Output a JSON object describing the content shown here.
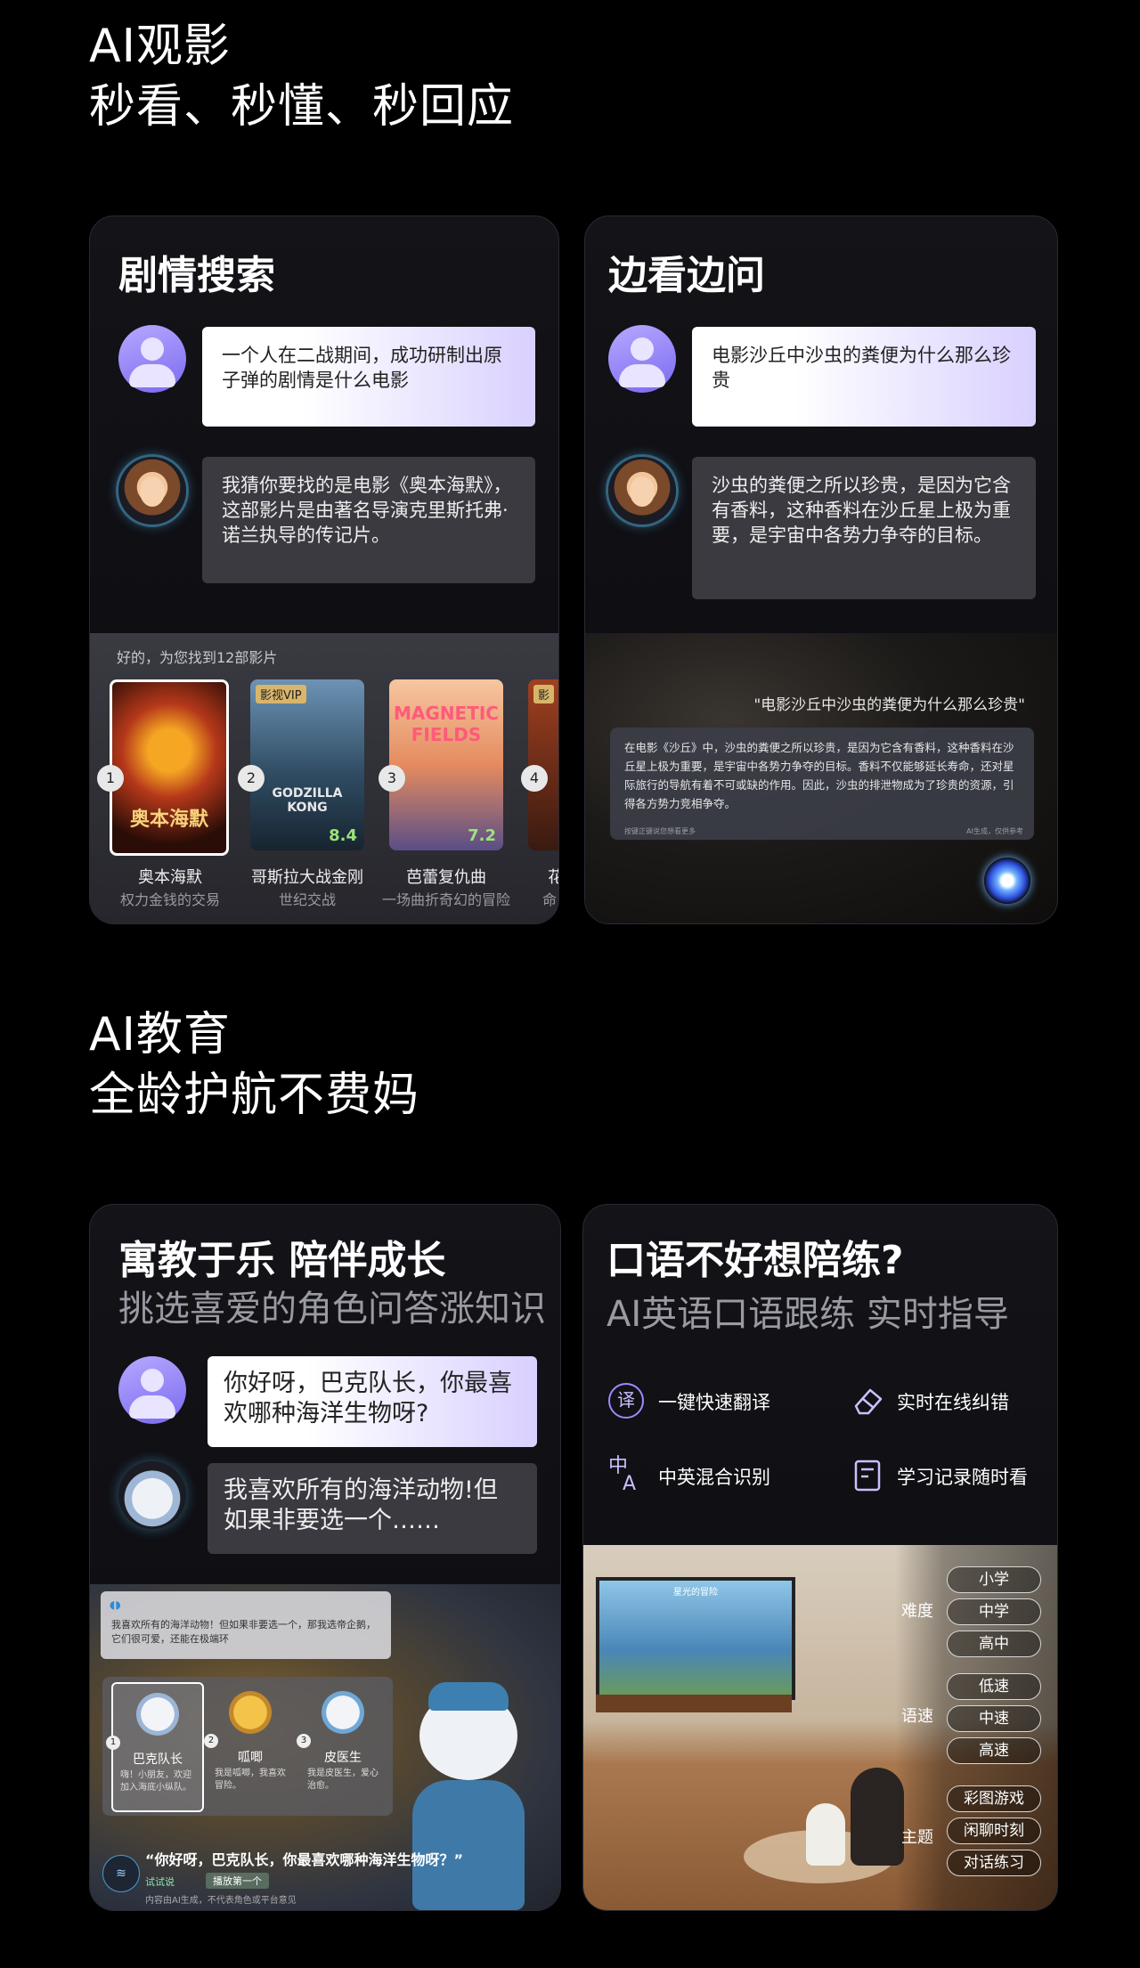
{
  "section1": {
    "title_line1": "AI观影",
    "title_line2": "秒看、秒懂、秒回应"
  },
  "card_search": {
    "title": "剧情搜索",
    "user_msg": "一个人在二战期间，成功研制出原子弹的剧情是什么电影",
    "ai_msg": "我猜你要找的是电影《奥本海默》，这部影片是由著名导演克里斯托弗·诺兰执导的传记片。",
    "result_header": "好的，为您找到12部影片",
    "movies": [
      {
        "num": "1",
        "title": "奥本海默",
        "sub": "权力金钱的交易",
        "poster_text": "奥本海默"
      },
      {
        "num": "2",
        "title": "哥斯拉大战金刚",
        "sub": "世纪交战",
        "poster_text": "GODZILLA KONG",
        "badge": "影视VIP",
        "score": "8.4"
      },
      {
        "num": "3",
        "title": "芭蕾复仇曲",
        "sub": "一场曲折奇幻的冒险",
        "poster_text": "MAGNETIC FIELDS",
        "score": "7.2"
      },
      {
        "num": "4",
        "title": "花",
        "sub": "命",
        "badge": "影"
      }
    ]
  },
  "card_ask": {
    "title": "边看边问",
    "user_msg": "电影沙丘中沙虫的粪便为什么那么珍贵",
    "ai_msg": "沙虫的粪便之所以珍贵，是因为它含有香料，这种香料在沙丘星上极为重要，是宇宙中各势力争夺的目标。",
    "overlay_query": "\"电影沙丘中沙虫的粪便为什么那么珍贵\"",
    "overlay_answer": "在电影《沙丘》中，沙虫的粪便之所以珍贵，是因为它含有香料，这种香料在沙丘星上极为重要，是宇宙中各势力争夺的目标。香料不仅能够延长寿命，还对星际旅行的导航有着不可或缺的作用。因此，沙虫的排泄物成为了珍贵的资源，引得各方势力竞相争夺。",
    "overlay_footer_left": "按键正键说您想看更多",
    "overlay_footer_right": "AI生成，仅供参考"
  },
  "section2": {
    "title_line1": "AI教育",
    "title_line2": "全龄护航不费妈"
  },
  "card_edu": {
    "title": "寓教于乐 陪伴成长",
    "subtitle": "挑选喜爱的角色问答涨知识",
    "user_msg": "你好呀，巴克队长，你最喜欢哪种海洋生物呀?",
    "ai_msg": "我喜欢所有的海洋动物!但如果非要选一个……",
    "popup_text": "我喜欢所有的海洋动物！但如果非要选一个，那我选帝企鹅，它们很可爱，还能在极端环",
    "characters": [
      {
        "num": "1",
        "name": "巴克队长",
        "desc": "嗨！小朋友，欢迎加入海底小纵队。"
      },
      {
        "num": "2",
        "name": "呱唧",
        "desc": "我是呱唧，我喜欢冒险。"
      },
      {
        "num": "3",
        "name": "皮医生",
        "desc": "我是皮医生，爱心治愈。"
      }
    ],
    "caption": "“你好呀，巴克队长，你最喜欢哪种海洋生物呀？”",
    "try_label": "试试说",
    "try_chip": "播放第一个",
    "footer_note": "内容由AI生成，不代表角色或平台意见"
  },
  "card_oral": {
    "title": "口语不好想陪练?",
    "subtitle": "AI英语口语跟练 实时指导",
    "features": [
      {
        "icon": "translate-icon",
        "label": "一键快速翻译"
      },
      {
        "icon": "eraser-icon",
        "label": "实时在线纠错"
      },
      {
        "icon": "bilingual-icon",
        "label": "中英混合识别"
      },
      {
        "icon": "record-icon",
        "label": "学习记录随时看"
      }
    ],
    "tv_screen_title": "星光的冒险",
    "groups": [
      {
        "label": "难度",
        "options": [
          "小学",
          "中学",
          "高中"
        ]
      },
      {
        "label": "语速",
        "options": [
          "低速",
          "中速",
          "高速"
        ]
      },
      {
        "label": "主题",
        "options": [
          "彩图游戏",
          "闲聊时刻",
          "对话练习"
        ]
      }
    ]
  },
  "colors": {
    "accent": "#8f7cff",
    "background": "#000000",
    "card_border": "#2a2a33"
  }
}
